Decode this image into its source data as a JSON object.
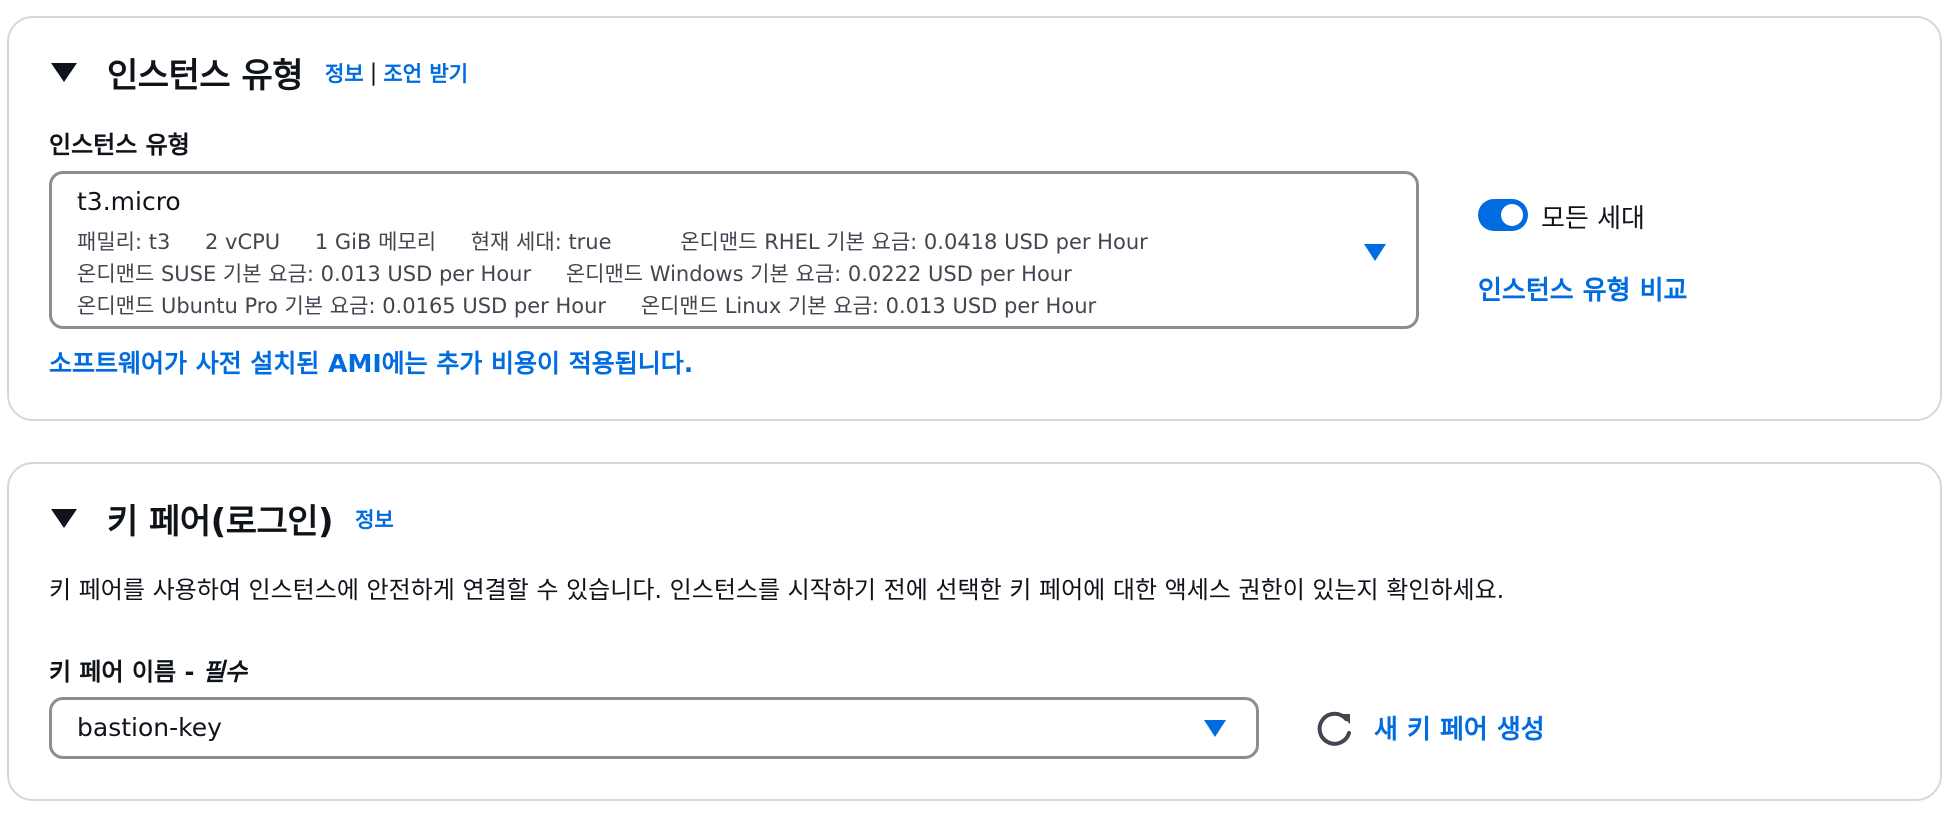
{
  "instance_section": {
    "title": "인스턴스 유형",
    "info_link": "정보",
    "separator": "|",
    "advice_link": "조언 받기",
    "field_label": "인스턴스 유형",
    "selected": {
      "name": "t3.micro",
      "family": "패밀리: t3",
      "vcpu": "2 vCPU",
      "memory": "1 GiB 메모리",
      "current_gen": "현재 세대: true",
      "rhel_price": "온디맨드 RHEL 기본 요금: 0.0418 USD per Hour",
      "suse_price": "온디맨드 SUSE 기본 요금: 0.013 USD per Hour",
      "windows_price": "온디맨드 Windows 기본 요금: 0.0222 USD per Hour",
      "ubuntu_price": "온디맨드 Ubuntu Pro 기본 요금: 0.0165 USD per Hour",
      "linux_price": "온디맨드 Linux 기본 요금: 0.013 USD per Hour"
    },
    "toggle_label": "모든 세대",
    "toggle_on": true,
    "compare_link": "인스턴스 유형 비교",
    "ami_notice": "소프트웨어가 사전 설치된 AMI에는 추가 비용이 적용됩니다."
  },
  "keypair_section": {
    "title": "키 페어(로그인)",
    "info_link": "정보",
    "description": "키 페어를 사용하여 인스턴스에 안전하게 연결할 수 있습니다. 인스턴스를 시작하기 전에 선택한 키 페어에 대한 액세스 권한이 있는지 확인하세요.",
    "field_label": "키 페어 이름 -",
    "field_required": "필수",
    "selected_value": "bastion-key",
    "create_link": "새 키 페어 생성"
  },
  "icons": {
    "collapse": "triangle-down-icon",
    "dropdown": "caret-down-icon",
    "refresh": "refresh-icon"
  },
  "colors": {
    "link": "#006ce0",
    "text": "#0f141a",
    "border": "#8c8c94",
    "panel_border": "#d5d8db"
  }
}
